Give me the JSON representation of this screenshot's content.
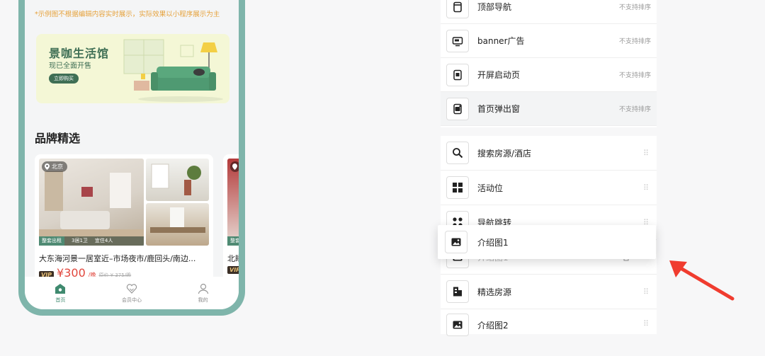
{
  "preview": {
    "hint": "*示例图不根据编辑内容实时展示，实际效果以小程序展示为主",
    "banner": {
      "title": "景咖生活馆",
      "subtitle": "现已全面开售",
      "button": "立即购买"
    },
    "section_title": "品牌精选",
    "card": {
      "location": "北京",
      "tags": [
        "整套出租",
        "3居1卫",
        "宜住4人"
      ],
      "name": "大东海河景一居室近–市场夜市/鹿回头/南边...",
      "vip": "VIP",
      "price": "¥300",
      "unit": "/晚",
      "original_price": "原价 ¥ 375/晚"
    },
    "card2": {
      "tag": "整套",
      "name": "北睡",
      "vip": "VIP"
    },
    "tabbar": [
      {
        "label": "首页",
        "icon": "home-icon"
      },
      {
        "label": "会员中心",
        "icon": "member-heart-icon"
      },
      {
        "label": "我的",
        "icon": "user-icon"
      }
    ]
  },
  "fixed_modules": [
    {
      "label": "顶部导航",
      "tip": "不支持排序",
      "icon": "top-nav-icon"
    },
    {
      "label": "banner广告",
      "tip": "不支持排序",
      "icon": "banner-ad-icon"
    },
    {
      "label": "开屏启动页",
      "tip": "不支持排序",
      "icon": "splash-icon"
    },
    {
      "label": "首页弹出窗",
      "tip": "不支持排序",
      "icon": "popup-icon"
    }
  ],
  "sortable_modules": [
    {
      "label": "搜索房源/酒店",
      "icon": "search-icon"
    },
    {
      "label": "活动位",
      "icon": "activity-grid-icon"
    },
    {
      "label": "导航跳转",
      "icon": "nav-jump-icon"
    },
    {
      "label": "介绍图1",
      "icon": "image-icon"
    },
    {
      "label": "精选房源",
      "icon": "building-icon"
    },
    {
      "label": "介绍图2",
      "icon": "image-icon"
    }
  ],
  "dragging": {
    "label": "介绍图1",
    "icon": "image-icon"
  },
  "colors": {
    "phone_frame": "#7fb5ab",
    "accent_green": "#3f8a6f",
    "price_red": "#e1463c",
    "arrow_red": "#f03c2f",
    "hint_orange": "#e6a23c"
  }
}
